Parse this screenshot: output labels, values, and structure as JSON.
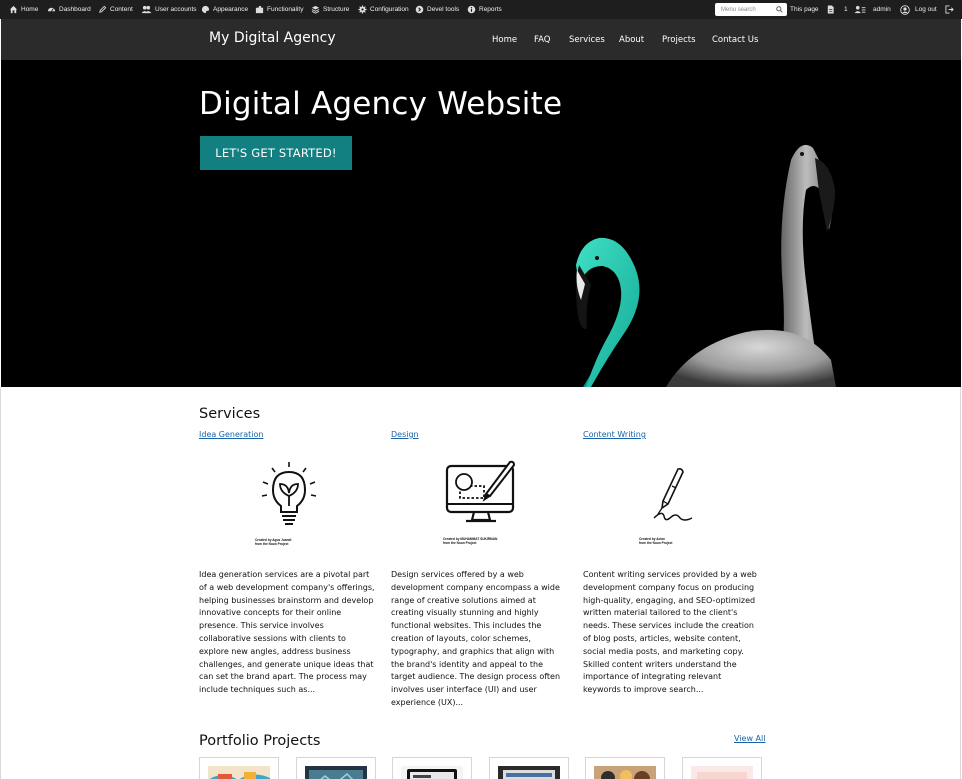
{
  "admin_toolbar": {
    "items": [
      {
        "label": "Home",
        "icon": "home-icon"
      },
      {
        "label": "Dashboard",
        "icon": "dashboard-icon"
      },
      {
        "label": "Content",
        "icon": "pencil-icon"
      },
      {
        "label": "User accounts",
        "icon": "users-icon"
      },
      {
        "label": "Appearance",
        "icon": "palette-icon"
      },
      {
        "label": "Functionality",
        "icon": "puzzle-icon"
      },
      {
        "label": "Structure",
        "icon": "layers-icon"
      },
      {
        "label": "Configuration",
        "icon": "gear-icon"
      },
      {
        "label": "Devel tools",
        "icon": "devel-icon"
      },
      {
        "label": "Reports",
        "icon": "info-icon"
      }
    ],
    "search_placeholder": "Menu search",
    "this_page": "This page",
    "count": "1",
    "user": "admin",
    "logout": "Log out"
  },
  "site": {
    "name": "My Digital Agency",
    "nav": [
      "Home",
      "FAQ",
      "Services",
      "About",
      "Projects",
      "Contact Us"
    ]
  },
  "hero": {
    "title": "Digital Agency Website",
    "cta": "LET'S GET STARTED!"
  },
  "services": {
    "heading": "Services",
    "items": [
      {
        "title": "Idea Generation",
        "icon": "lightbulb-icon",
        "credit_line1": "Created by Agus Juandi",
        "credit_line2": "from the Noun Project",
        "desc": "Idea generation services are a pivotal part of a web development company's offerings, helping businesses brainstorm and develop innovative concepts for their online presence. This service involves collaborative sessions with clients to explore new angles, address business challenges, and generate unique ideas that can set the brand apart. The process may include techniques such as..."
      },
      {
        "title": "Design",
        "icon": "design-monitor-icon",
        "credit_line1": "Created by MUHAMMAT SUKIRMAN",
        "credit_line2": "from the Noun Project",
        "desc": "Design services offered by a web development company encompass a wide range of creative solutions aimed at creating visually stunning and highly functional websites. This includes the creation of layouts, color schemes, typography, and graphics that align with the brand's identity and appeal to the target audience. The design process often involves user interface (UI) and user experience (UX)..."
      },
      {
        "title": "Content Writing",
        "icon": "pen-icon",
        "credit_line1": "Created by Aclan",
        "credit_line2": "from the Noun Project",
        "desc": "Content writing services provided by a web development company focus on producing high-quality, engaging, and SEO-optimized written material tailored to the client's needs. These services include the creation of blog posts, articles, website content, social media posts, and marketing copy. Skilled content writers understand the importance of integrating relevant keywords to improve search..."
      }
    ]
  },
  "portfolio": {
    "heading": "Portfolio Projects",
    "view_all": "View All",
    "thumb_count": 6
  },
  "colors": {
    "toolbar_bg": "#1e1e1e",
    "nav_bg": "#2b2b2b",
    "cta_bg": "#127f80",
    "link": "#1a63a8",
    "flamingo_teal": "#22c9b0"
  }
}
